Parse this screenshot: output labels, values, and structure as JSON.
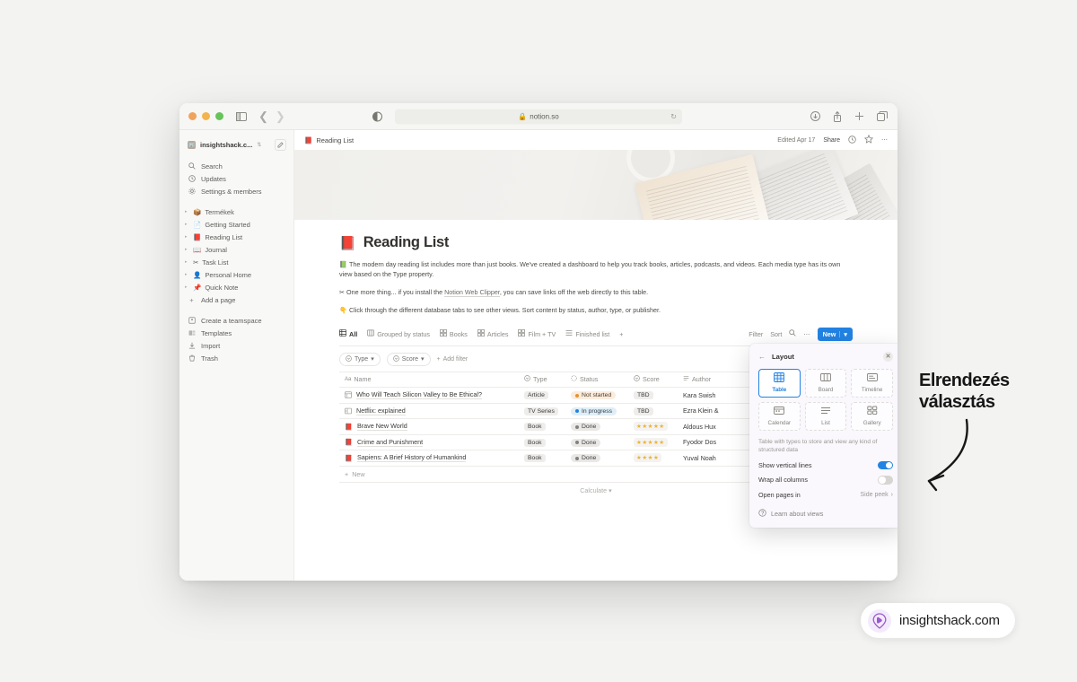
{
  "browser": {
    "url": "notion.so",
    "lock_icon": "lock-icon",
    "reload_icon": "reload-icon",
    "icons": [
      "download-icon",
      "share-icon",
      "plus-icon",
      "tabs-icon"
    ]
  },
  "sidebar": {
    "workspace": "insightshack.c...",
    "nav": [
      {
        "label": "Search",
        "icon": "search-icon"
      },
      {
        "label": "Updates",
        "icon": "clock-icon"
      },
      {
        "label": "Settings & members",
        "icon": "gear-icon"
      }
    ],
    "pages": [
      {
        "label": "Termékek",
        "emoji": "📦",
        "active": false
      },
      {
        "label": "Getting Started",
        "emoji": "📄",
        "active": false
      },
      {
        "label": "Reading List",
        "emoji": "📕",
        "active": true
      },
      {
        "label": "Journal",
        "emoji": "📖",
        "active": false
      },
      {
        "label": "Task List",
        "emoji": "✂️",
        "active": false
      },
      {
        "label": "Personal Home",
        "emoji": "👤",
        "active": false
      },
      {
        "label": "Quick Note",
        "emoji": "📌",
        "active": false
      }
    ],
    "add_page": "Add a page",
    "footer": [
      {
        "label": "Create a teamspace",
        "icon": "teamspace-icon"
      },
      {
        "label": "Templates",
        "icon": "templates-icon"
      },
      {
        "label": "Import",
        "icon": "import-icon"
      },
      {
        "label": "Trash",
        "icon": "trash-icon"
      }
    ]
  },
  "topbar": {
    "breadcrumb": "Reading List",
    "edited": "Edited Apr 17",
    "share": "Share",
    "icons": [
      "clock-icon",
      "star-icon",
      "more-icon"
    ]
  },
  "page": {
    "emoji": "📕",
    "title": "Reading List",
    "paragraphs": [
      {
        "emoji": "📗",
        "pre": "The modern day reading list includes more than just books. We've created a dashboard to help you track books, articles, podcasts, and videos. Each media type has its own view based on the Type property.",
        "link": "",
        "post": ""
      },
      {
        "emoji": "✂️",
        "pre": "One more thing... if you install the ",
        "link": "Notion Web Clipper",
        "post": ", you can save links off the web directly to this table."
      },
      {
        "emoji": "👇",
        "pre": "Click through the different database tabs to see other views. Sort content by status, author, type, or publisher.",
        "link": "",
        "post": ""
      }
    ]
  },
  "database": {
    "tabs": [
      {
        "label": "All",
        "icon": "table-icon",
        "active": true
      },
      {
        "label": "Grouped by status",
        "icon": "board-icon",
        "active": false
      },
      {
        "label": "Books",
        "icon": "gallery-icon",
        "active": false
      },
      {
        "label": "Articles",
        "icon": "gallery-icon",
        "active": false
      },
      {
        "label": "Film + TV",
        "icon": "gallery-icon",
        "active": false
      },
      {
        "label": "Finished list",
        "icon": "list-icon",
        "active": false
      }
    ],
    "add_tab": "+",
    "toolbar": {
      "filter": "Filter",
      "sort": "Sort",
      "search_icon": "search-icon",
      "more_icon": "more-icon",
      "new_button": "New",
      "new_chevron": "chevron-down-icon"
    },
    "filters": [
      {
        "label": "Type",
        "icon": "property-icon"
      },
      {
        "label": "Score",
        "icon": "property-icon"
      }
    ],
    "add_filter": "Add filter",
    "columns": [
      {
        "label": "Name",
        "icon": "Aa"
      },
      {
        "label": "Type",
        "icon": "select-icon"
      },
      {
        "label": "Status",
        "icon": "status-icon"
      },
      {
        "label": "Score",
        "icon": "select-icon"
      },
      {
        "label": "Author",
        "icon": "text-icon"
      }
    ],
    "rows": [
      {
        "icon": "article-icon",
        "name": "Who Will Teach Silicon Valley to Be Ethical?",
        "type": "Article",
        "status": "Not started",
        "status_class": "st-not",
        "score": "TBD",
        "score_stars": 0,
        "author": "Kara Swish"
      },
      {
        "icon": "tv-icon",
        "name": "Netflix: explained",
        "type": "TV Series",
        "status": "In progress",
        "status_class": "st-prog",
        "score": "TBD",
        "score_stars": 0,
        "author": "Ezra Klein &"
      },
      {
        "icon": "book-icon",
        "name": "Brave New World",
        "type": "Book",
        "status": "Done",
        "status_class": "st-done",
        "score": "",
        "score_stars": 5,
        "author": "Aldous Hux"
      },
      {
        "icon": "book-icon",
        "name": "Crime and Punishment",
        "type": "Book",
        "status": "Done",
        "status_class": "st-done",
        "score": "",
        "score_stars": 5,
        "author": "Fyodor Dos"
      },
      {
        "icon": "book-icon",
        "name": "Sapiens: A Brief History of Humankind",
        "type": "Book",
        "status": "Done",
        "status_class": "st-done",
        "score": "",
        "score_stars": 4,
        "author": "Yuval Noah"
      }
    ],
    "new_row": "New",
    "calculate": "Calculate"
  },
  "popover": {
    "title": "Layout",
    "back_icon": "back-arrow-icon",
    "close_icon": "close-icon",
    "options": [
      {
        "label": "Table",
        "icon": "table-icon",
        "selected": true
      },
      {
        "label": "Board",
        "icon": "board-icon",
        "selected": false
      },
      {
        "label": "Timeline",
        "icon": "timeline-icon",
        "selected": false
      },
      {
        "label": "Calendar",
        "icon": "calendar-icon",
        "selected": false
      },
      {
        "label": "List",
        "icon": "list-icon",
        "selected": false
      },
      {
        "label": "Gallery",
        "icon": "gallery-icon",
        "selected": false
      }
    ],
    "description": "Table with types to store and view any kind of structured data",
    "settings": [
      {
        "label": "Show vertical lines",
        "type": "toggle",
        "value": true
      },
      {
        "label": "Wrap all columns",
        "type": "toggle",
        "value": false
      },
      {
        "label": "Open pages in",
        "type": "select",
        "value": "Side peek"
      }
    ],
    "learn": "Learn about views",
    "accent_color": "#2383e2"
  },
  "annotation": {
    "line1": "Elrendezés",
    "line2": "választás"
  },
  "brand": {
    "name": "insightshack.com",
    "logo": "insightshack-pin-logo",
    "logo_color": "#9b59d0"
  }
}
